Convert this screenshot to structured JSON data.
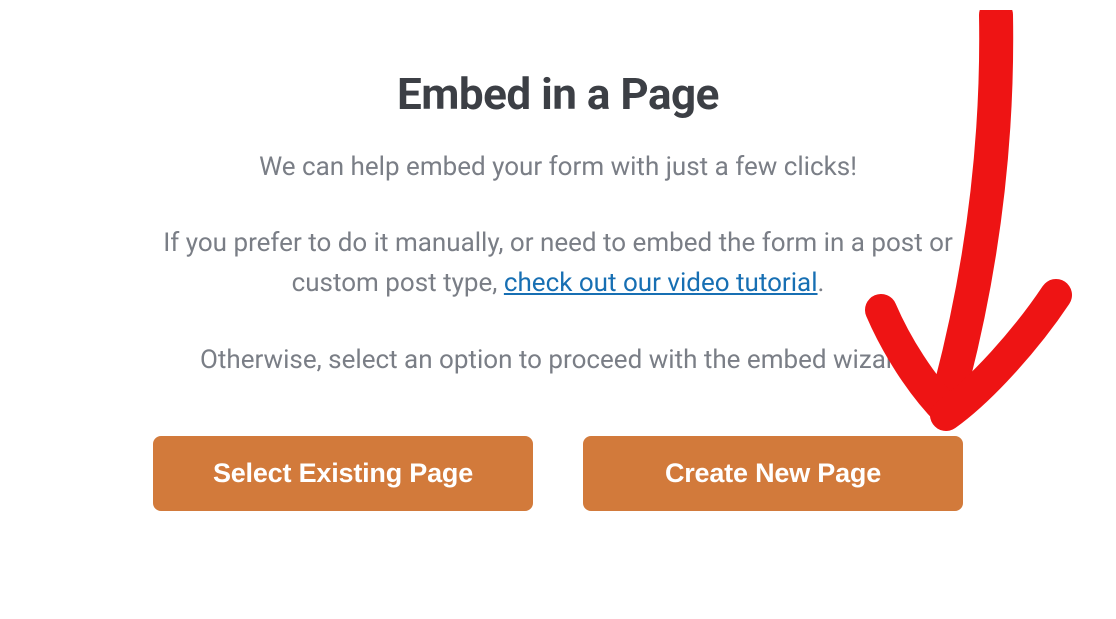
{
  "modal": {
    "title": "Embed in a Page",
    "subtitle": "We can help embed your form with just a few clicks!",
    "body_text_1": "If you prefer to do it manually, or need to embed the form in a post or custom post type, ",
    "body_link": "check out our video tutorial",
    "body_text_2": ".",
    "footer_text": "Otherwise, select an option to proceed with the embed wizard.",
    "buttons": {
      "select_existing": "Select Existing Page",
      "create_new": "Create New Page"
    }
  },
  "colors": {
    "accent": "#d27a3b",
    "link": "#176fb3",
    "heading": "#3c3f45",
    "body_text": "#7a7e86",
    "annotation": "#ee1414"
  }
}
